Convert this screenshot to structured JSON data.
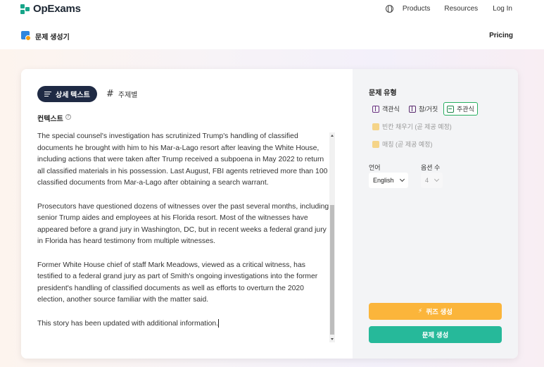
{
  "header": {
    "brand": "OpExams",
    "nav": [
      "Products",
      "Resources",
      "Log In"
    ],
    "globe_icon": "globe-icon"
  },
  "subheader": {
    "title": "문제 생성기",
    "pricing": "Pricing"
  },
  "tabs": {
    "active": "상세 텍스트",
    "other": "주제별"
  },
  "context": {
    "label": "컨텍스트",
    "paragraphs": [
      "The special counsel's investigation has scrutinized Trump's handling of classified documents he brought with him to his Mar-a-Lago resort after leaving the White House, including actions that were taken after Trump received a subpoena in May 2022 to return all classified materials in his possession. Last August, FBI agents retrieved more than 100 classified documents from Mar-a-Lago after obtaining a search warrant.",
      "Prosecutors have questioned dozens of witnesses over the past several months, including senior Trump aides and employees at his Florida resort. Most of the witnesses have appeared before a grand jury in Washington, DC, but in recent weeks a federal grand jury in Florida has heard testimony from multiple witnesses.",
      "Former White House chief of staff Mark Meadows, viewed as a critical witness, has testified to a federal grand jury as part of Smith's ongoing investigations into the former president's handling of classified documents as well as efforts to overturn the 2020 election, another source familiar with the matter said.",
      "This story has been updated with additional information."
    ]
  },
  "question_type": {
    "label": "문제 유형",
    "options": [
      {
        "label": "객관식",
        "selected": false,
        "disabled": false
      },
      {
        "label": "참/거짓",
        "selected": false,
        "disabled": false
      },
      {
        "label": "주관식",
        "selected": true,
        "disabled": false
      },
      {
        "label": "빈칸 채우기 (곧 제공 예정)",
        "selected": false,
        "disabled": true
      },
      {
        "label": "매칭 (곧 제공 예정)",
        "selected": false,
        "disabled": true
      }
    ]
  },
  "language": {
    "label": "언어",
    "value": "English"
  },
  "option_count": {
    "label": "옵션 수",
    "value": "4"
  },
  "buttons": {
    "quiz": "퀴즈 생성",
    "generate": "문제 생성"
  },
  "colors": {
    "accent_dark": "#1f2a44",
    "quiz_button": "#fbb53b",
    "generate_button": "#26b99a",
    "brand": "#17a589"
  }
}
